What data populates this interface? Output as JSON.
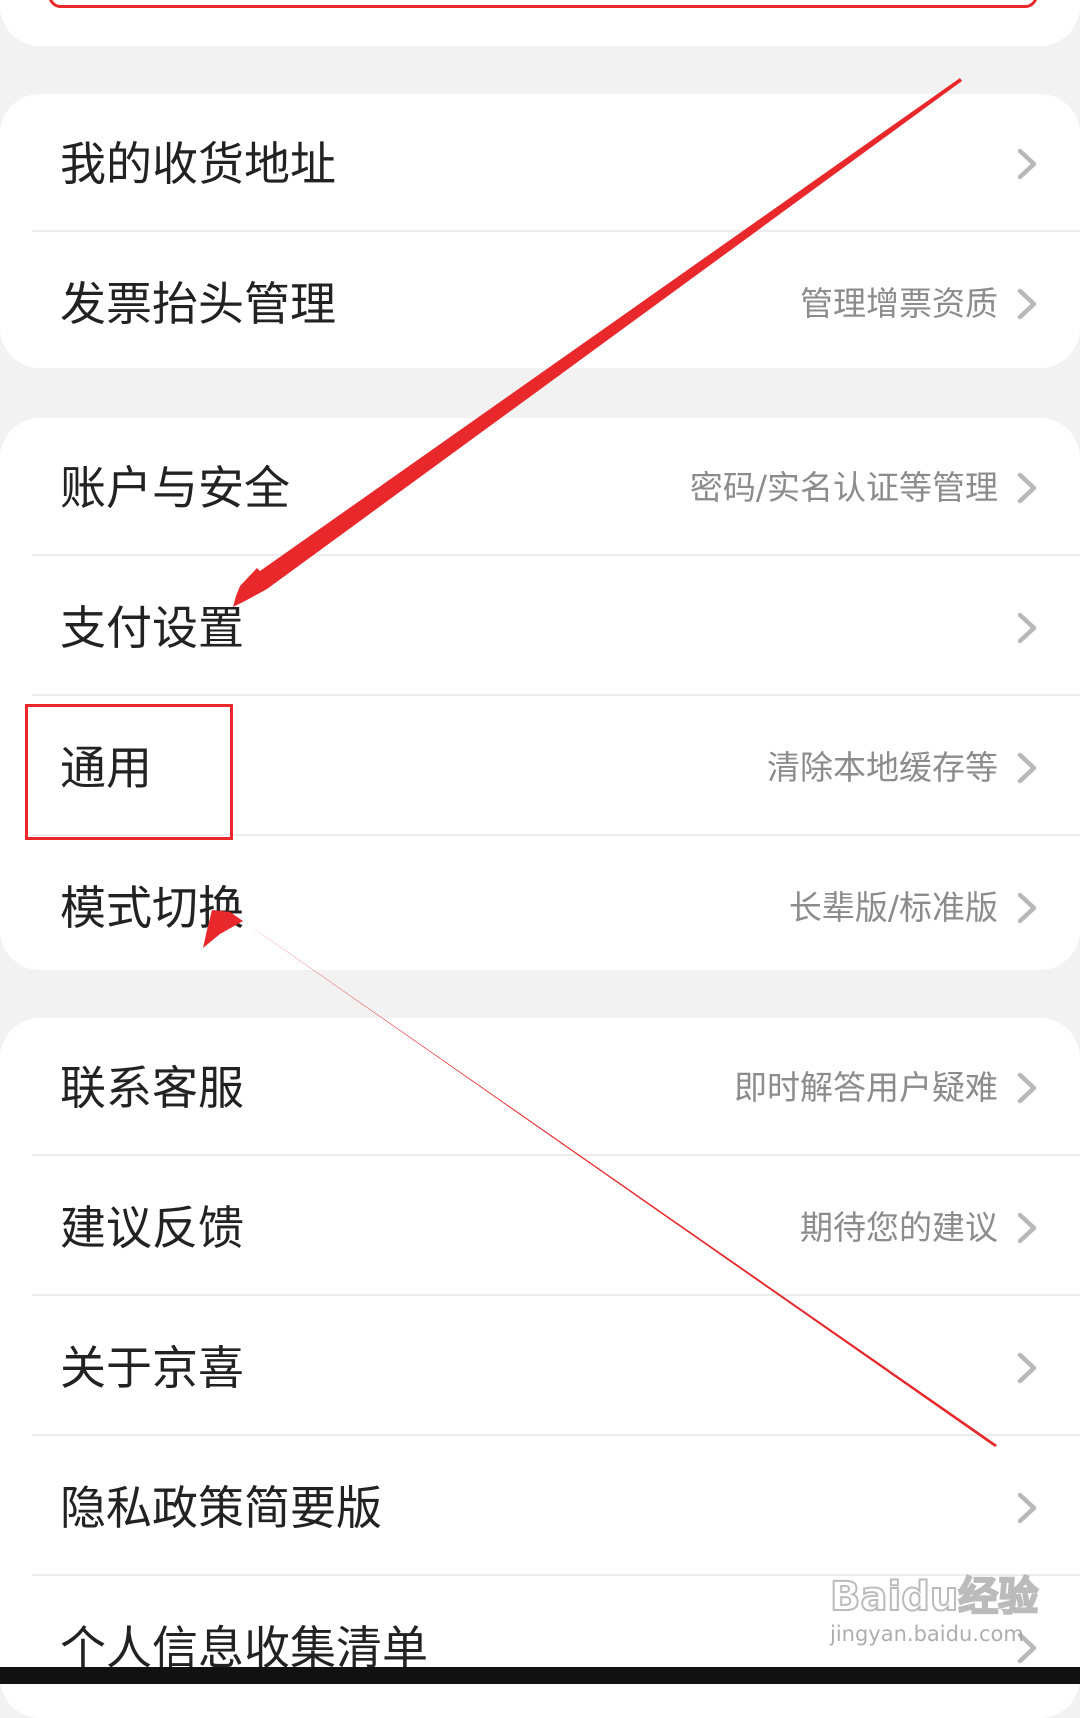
{
  "sections": [
    {
      "items": [
        {
          "label": "我的收货地址",
          "desc": ""
        },
        {
          "label": "发票抬头管理",
          "desc": "管理增票资质"
        }
      ]
    },
    {
      "items": [
        {
          "label": "账户与安全",
          "desc": "密码/实名认证等管理"
        },
        {
          "label": "支付设置",
          "desc": ""
        },
        {
          "label": "通用",
          "desc": "清除本地缓存等"
        },
        {
          "label": "模式切换",
          "desc": "长辈版/标准版"
        }
      ]
    },
    {
      "items": [
        {
          "label": "联系客服",
          "desc": "即时解答用户疑难"
        },
        {
          "label": "建议反馈",
          "desc": "期待您的建议"
        },
        {
          "label": "关于京喜",
          "desc": ""
        },
        {
          "label": "隐私政策简要版",
          "desc": ""
        },
        {
          "label": "个人信息收集清单",
          "desc": ""
        }
      ]
    }
  ],
  "watermark": {
    "brand": "Baidu经验",
    "url": "jingyan.baidu.com"
  },
  "colors": {
    "annotation_red": "#e8282b",
    "label_text": "#222222",
    "desc_text": "#8c8c8c",
    "background": "#f2f2f2"
  }
}
